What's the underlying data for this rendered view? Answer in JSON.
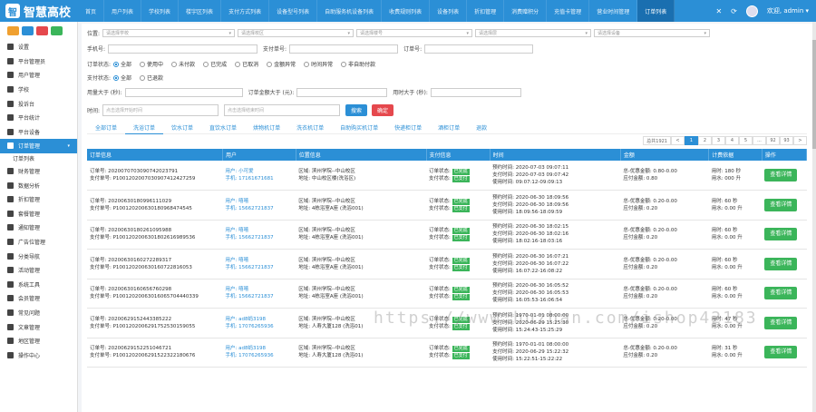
{
  "app": {
    "logo": "智慧高校",
    "user": "欢迎, admin ▾"
  },
  "nav": [
    "首页",
    "用户列表",
    "学校列表",
    "楼宇区列表",
    "支付方式列表",
    "设备型号列表",
    "自助服务机设备列表",
    "收费规则列表",
    "设备列表",
    "折扣管理",
    "消费赠积分",
    "充值卡管理",
    "营业时间管理",
    "订单列表"
  ],
  "menu": [
    "设置",
    "平台管理员",
    "用户管理",
    "学校",
    "投诉台",
    "平台统计",
    "平台设备",
    "订单管理",
    "订单列表",
    "财务管理",
    "数据分析",
    "折扣管理",
    "套餐管理",
    "通知管理",
    "广告位管理",
    "分类导航",
    "活动管理",
    "系统工具",
    "会员管理",
    "常见问题",
    "文章管理",
    "地区管理",
    "操作中心"
  ],
  "filters": {
    "location_label": "位置:",
    "school_ph": "请选择学校",
    "campus_ph": "请选择校区",
    "building_ph": "请选择楼号",
    "floor_ph": "请选择层",
    "device_ph": "请选择设备",
    "phone_label": "手机号:",
    "payno_label": "支付单号:",
    "orderno_label": "订单号:",
    "status_label": "订单状态:",
    "status_opts": [
      "全部",
      "使用中",
      "未付款",
      "已完成",
      "已取消",
      "金额异常",
      "时间异常",
      "非自助付款"
    ],
    "paystatus_label": "支付状态:",
    "paystatus_opts": [
      "全部",
      "已退款"
    ],
    "usage_label": "用量大于 (秒):",
    "amount_label": "订单金额大于 (元):",
    "usetime_label": "用时大于 (秒):",
    "time_label": "时间:",
    "start_ph": "点击选择开始时间",
    "end_ph": "点击选择结束时间",
    "search_btn": "搜索",
    "confirm_btn": "确定"
  },
  "tabs": [
    "全部订单",
    "洗浴订单",
    "饮水订单",
    "直饮水订单",
    "烘物机订单",
    "洗衣机订单",
    "自助购买机订单",
    "快递柜订单",
    "酒柜订单",
    "退款"
  ],
  "pager": [
    "总共1921",
    "<",
    "1",
    "2",
    "3",
    "4",
    "5",
    "...",
    "92",
    "93",
    ">"
  ],
  "columns": [
    "订单信息",
    "用户",
    "位置信息",
    "支付信息",
    "时间",
    "金额",
    "计费依据",
    "操作"
  ],
  "orders": [
    {
      "no": "订单号: 20200707030907420​23791",
      "pay": "支付单号: P10012020070309074​12427259",
      "user": "小可爱",
      "phone": "17161671681",
      "area": "区域: 滨州学院--中山校区",
      "addr": "地址: 中山校区楼(洗浴区)",
      "st1": "已完成",
      "st2": "已支付",
      "t1": "预约时间: 2020-07-03 09:07:11",
      "t2": "支付时间: 2020-07-03 09:07:42",
      "t3": "使用时间: 09:07:12-09:09:13",
      "m1": "总-优惠金额: 0.80-0.00",
      "m2": "应付金额: 0.80",
      "b1": "用时: 180 秒",
      "b2": "用水: 000 升"
    },
    {
      "no": "订单号: 202006301809961110​29",
      "pay": "支付单号: P10012020063018096​8474545",
      "user": "嘻嘻",
      "phone": "15662721837",
      "area": "区域: 滨州学院--中山校区",
      "addr": "地址: 4栋浴室A座 (洗浴001)",
      "st1": "已完成",
      "st2": "已支付",
      "t1": "预约时间: 2020-06-30 18:09:56",
      "t2": "支付时间: 2020-06-30 18:09:56",
      "t3": "使用时间: 18:09:56-18:09:59",
      "m1": "总-优惠金额: 0.20-0.00",
      "m2": "应付金额: 0.20",
      "b1": "用时: 60 秒",
      "b2": "用水: 0.00 升"
    },
    {
      "no": "订单号: 20200630180261​095988",
      "pay": "支付单号: P10012020063018026​16989536",
      "user": "嘻嘻",
      "phone": "15662721837",
      "area": "区域: 滨州学院--中山校区",
      "addr": "地址: 4栋浴室A座 (洗浴001)",
      "st1": "已完成",
      "st2": "已支付",
      "t1": "预约时间: 2020-06-30 18:02:15",
      "t2": "支付时间: 2020-06-30 18:02:16",
      "t3": "使用时间: 18:02:16-18:03:16",
      "m1": "总-优惠金额: 0.20-0.00",
      "m2": "应付金额: 0.20",
      "b1": "用时: 60 秒",
      "b2": "用水: 0.00 升"
    },
    {
      "no": "订单号: 20200630160272289317",
      "pay": "支付单号: P10012020063016072​2816053",
      "user": "嘻嘻",
      "phone": "15662721837",
      "area": "区域: 滨州学院--中山校区",
      "addr": "地址: 4栋浴室A座 (洗浴001)",
      "st1": "已完成",
      "st2": "已支付",
      "t1": "预约时间: 2020-06-30 16:07:21",
      "t2": "支付时间: 2020-06-30 16:07:22",
      "t3": "使用时间: 16:07:22-16:08:22",
      "m1": "总-优惠金额: 0.20-0.00",
      "m2": "应付金额: 0.20",
      "b1": "用时: 60 秒",
      "b2": "用水: 0.00 升"
    },
    {
      "no": "订单号: 202006301606567​60298",
      "pay": "支付单号: P10012020063016065​704440339",
      "user": "嘻嘻",
      "phone": "15662721837",
      "area": "区域: 滨州学院--中山校区",
      "addr": "地址: 4栋浴室A座 (洗浴001)",
      "st1": "已完成",
      "st2": "已支付",
      "t1": "预约时间: 2020-06-30 16:05:52",
      "t2": "支付时间: 2020-06-30 16:05:53",
      "t3": "使用时间: 16:05:53-16:06:54",
      "m1": "总-优惠金额: 0.20-0.00",
      "m2": "应付金额: 0.20",
      "b1": "用时: 60 秒",
      "b2": "用水: 0.00 升"
    },
    {
      "no": "订单号: 20200629152443385222",
      "pay": "支付单号: P10012020062917525​30159055",
      "user": "ad8蚂3198",
      "phone": "17076265936",
      "area": "区域: 滨州学院--中山校区",
      "addr": "地址: 人寿大厦128 (洗浴01)",
      "st1": "已完成",
      "st2": "已支付",
      "t1": "预约时间: 1970-01-01 08:00:00",
      "t2": "支付时间: 2020-06-29 15:25:30",
      "t3": "使用时间: 15:24:43-15:25:29",
      "m1": "总-优惠金额: 0.20-0.00",
      "m2": "应付金额: 0.20",
      "b1": "用时: 47 秒",
      "b2": "用水: 0.00 升"
    },
    {
      "no": "订单号: 2020062915225​1046721",
      "pay": "支付单号: P10012020062915223​22180676",
      "user": "ad8蚂3198",
      "phone": "17076265936",
      "area": "区域: 滨州学院--中山校区",
      "addr": "地址: 人寿大厦128 (洗浴01)",
      "st1": "已完成",
      "st2": "已支付",
      "t1": "预约时间: 1970-01-01 08:00:00",
      "t2": "支付时间: 2020-06-29 15:22:32",
      "t3": "使用时间: 15:22:51-15:22:22",
      "m1": "总-优惠金额: 0.20-0.00",
      "m2": "应付金额: 0.20",
      "b1": "用时: 31 秒",
      "b2": "用水: 0.00 升"
    }
  ],
  "detail_btn": "查看详情",
  "watermark": "https://www.huzhan.com/ishop42183"
}
